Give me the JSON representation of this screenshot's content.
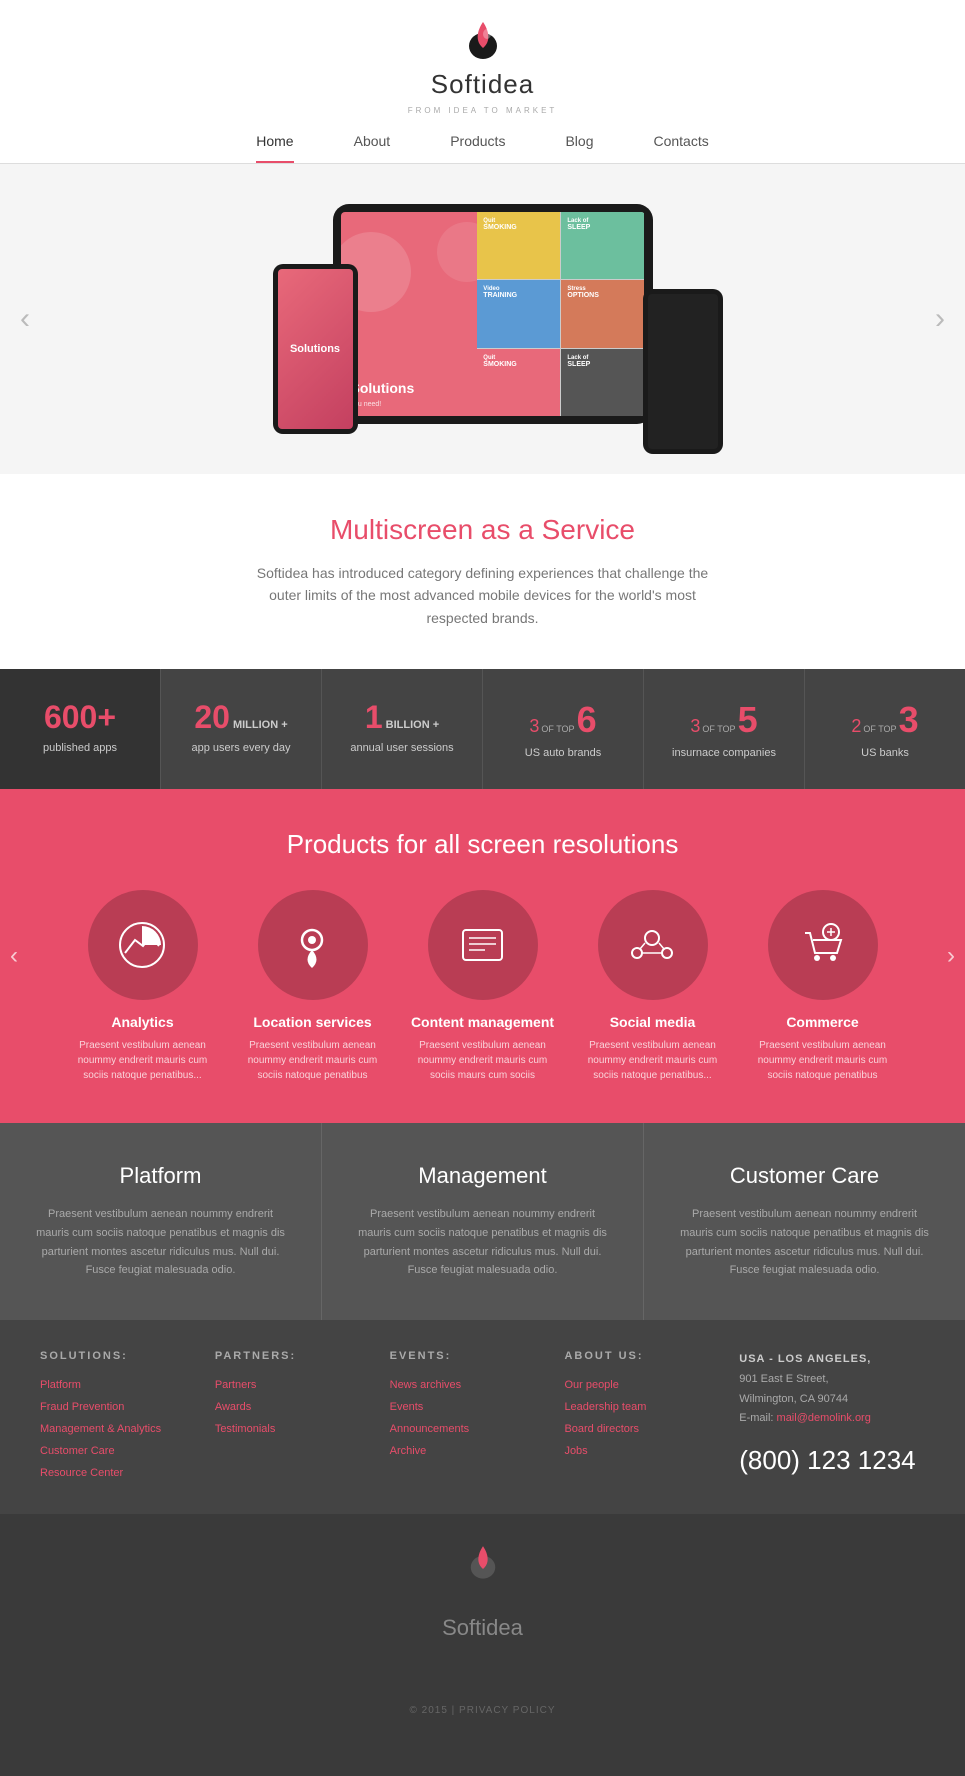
{
  "brand": {
    "name": "Softidea",
    "tagline": "FROM IDEA TO MARKET",
    "copyright": "© 2015 | PRIVACY POLICY"
  },
  "nav": {
    "items": [
      {
        "label": "Home",
        "active": true
      },
      {
        "label": "About",
        "active": false
      },
      {
        "label": "Products",
        "active": false
      },
      {
        "label": "Blog",
        "active": false
      },
      {
        "label": "Contacts",
        "active": false
      }
    ]
  },
  "hero": {
    "arrow_left": "‹",
    "arrow_right": "›"
  },
  "multiscreen": {
    "heading": "Multiscreen as a Service",
    "body": "Softidea has introduced category defining experiences that challenge the outer limits of the most advanced mobile devices for the world's most respected brands."
  },
  "stats": [
    {
      "number": "600+",
      "label": "published apps",
      "style": "dark"
    },
    {
      "prefix": "20",
      "suffix": "MILLION +",
      "label": "app users every day"
    },
    {
      "prefix": "1",
      "suffix": "BILLION +",
      "label": "annual user sessions"
    },
    {
      "prefix": "3",
      "of_top": "OF TOP",
      "big": "6",
      "label": "US auto brands"
    },
    {
      "prefix": "3",
      "of_top": "OF TOP",
      "big": "5",
      "label": "insurnace companies"
    },
    {
      "prefix": "2",
      "of_top": "OF TOP",
      "big": "3",
      "label": "US banks"
    }
  ],
  "products": {
    "heading": "Products for all screen resolutions",
    "arrow_left": "‹",
    "arrow_right": "›",
    "items": [
      {
        "name": "Analytics",
        "icon": "analytics",
        "desc": "Praesent vestibulum aenean noummy endrerit mauris cum sociis natoque penatibus..."
      },
      {
        "name": "Location services",
        "icon": "location",
        "desc": "Praesent vestibulum aenean noummy endrerit mauris cum sociis natoque penatibus"
      },
      {
        "name": "Content management",
        "icon": "content",
        "desc": "Praesent vestibulum aenean noummy endrerit mauris cum sociis maurs cum sociis"
      },
      {
        "name": "Social media",
        "icon": "social",
        "desc": "Praesent vestibulum aenean noummy endrerit mauris cum sociis natoque penatibus..."
      },
      {
        "name": "Commerce",
        "icon": "commerce",
        "desc": "Praesent vestibulum aenean noummy endrerit mauris cum sociis natoque penatibus"
      }
    ]
  },
  "platform": {
    "columns": [
      {
        "title": "Platform",
        "desc": "Praesent vestibulum aenean noummy endrerit mauris cum sociis natoque penatibus et magnis dis parturient montes ascetur ridiculus mus. Null dui. Fusce feugiat malesuada odio."
      },
      {
        "title": "Management",
        "desc": "Praesent vestibulum aenean noummy endrerit mauris cum sociis natoque penatibus et magnis dis parturient montes ascetur ridiculus mus. Null dui. Fusce feugiat malesuada odio."
      },
      {
        "title": "Customer Care",
        "desc": "Praesent vestibulum aenean noummy endrerit mauris cum sociis natoque penatibus et magnis dis parturient montes ascetur ridiculus mus. Null dui. Fusce feugiat malesuada odio."
      }
    ]
  },
  "footer": {
    "solutions": {
      "heading": "SOLUTIONS:",
      "links": [
        "Platform",
        "Fraud Prevention",
        "Management & Analytics",
        "Customer Care",
        "Resource Center"
      ]
    },
    "partners": {
      "heading": "PARTNERS:",
      "links": [
        "Partners",
        "Awards",
        "Testimonials"
      ]
    },
    "events": {
      "heading": "EVENTS:",
      "links": [
        "News archives",
        "Events",
        "Announcements",
        "Archive"
      ]
    },
    "about": {
      "heading": "ABOUT US:",
      "links": [
        "Our people",
        "Leadership team",
        "Board directors",
        "Jobs"
      ]
    },
    "address": {
      "city": "USA - LOS ANGELES,",
      "street": "901 East E Street,",
      "location": "Wilmington, CA 90744",
      "email_label": "E-mail:",
      "email": "mail@demolink.org",
      "phone": "(800) 123 1234"
    }
  }
}
